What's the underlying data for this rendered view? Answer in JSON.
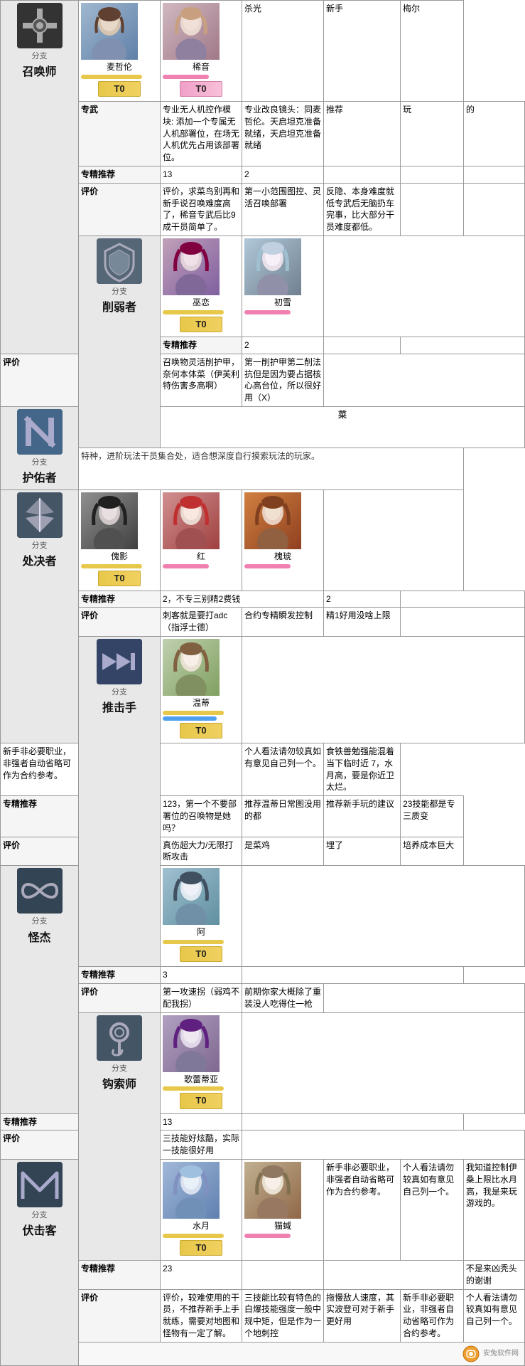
{
  "branches": [
    {
      "id": "summon",
      "name": "召唤师",
      "prefix": "分支",
      "icon_symbol": "⊕",
      "icon_bg": "#444",
      "characters": [
        {
          "name": "麦哲伦",
          "avatar_class": "avatar-麦哲伦",
          "tier": "T0",
          "tier_color": "gold",
          "bar_color": "gold"
        },
        {
          "name": "稀音",
          "avatar_class": "avatar-稀音",
          "tier": "T0",
          "tier_color": "pink",
          "bar_color": "pink"
        }
      ],
      "extra_headers": [
        "杀光",
        "新手",
        "梅尔"
      ],
      "specialty": {
        "label": "专武",
        "values": [
          "专业无人机控作模块: 添加一个专属无人机部署位，在场无人机优先占用该部署位。",
          "专业改良镜头: 同麦哲伦。天启坦克准备就绪, 天启坦克准备就绪",
          "推荐",
          "玩",
          "的"
        ]
      },
      "specialty_recommend": {
        "label": "专精推荐",
        "values": [
          "13",
          "2",
          "",
          "",
          ""
        ]
      },
      "evaluation": {
        "label": "评价",
        "value": "评价，求菜鸟别再和新手说召唤难度高了，稀音专武后比9成干员简单了。",
        "values": [
          "第一小范围图控、灵活召唤部署",
          "反隐、本身难度就低专武后无脑扔车完事，比大部分干员难度都低。",
          "",
          "",
          ""
        ]
      }
    },
    {
      "id": "weaken",
      "name": "削弱者",
      "prefix": "分支",
      "icon_symbol": "◇",
      "icon_bg": "#556",
      "characters": [
        {
          "name": "巫恋",
          "avatar_class": "avatar-巫恋",
          "tier": "T0",
          "tier_color": "gold",
          "bar_color": "gold"
        },
        {
          "name": "初雪",
          "avatar_class": "avatar-初雪",
          "tier": "",
          "tier_color": "pink",
          "bar_color": "pink"
        }
      ],
      "extra_headers": [],
      "specialty_recommend": {
        "label": "专精推荐",
        "values": [
          "2",
          "",
          "",
          "",
          ""
        ]
      },
      "evaluation": {
        "label": "评价",
        "values": [
          "召唤物灵活削护甲，奈何本体菜（伊芙利特伤害多高啊）",
          "第一削护甲第二削法抗但是因为要占据核心高台位，所以很好用（X）",
          "",
          "",
          ""
        ]
      }
    },
    {
      "id": "guard",
      "name": "护佑者",
      "prefix": "分支",
      "icon_symbol": "N",
      "icon_bg": "#446",
      "characters": [],
      "big_char": "菜",
      "extra_headers": [],
      "note": "特种，进阶玩法干员集合处，适合想深度自行摸索玩法的玩家。"
    },
    {
      "id": "execute",
      "name": "处决者",
      "prefix": "分支",
      "icon_symbol": "▲",
      "icon_bg": "#445",
      "characters": [
        {
          "name": "傀影",
          "avatar_class": "avatar-傀影",
          "tier": "T0",
          "tier_color": "gold",
          "bar_color": "gold"
        },
        {
          "name": "红",
          "avatar_class": "avatar-红",
          "tier": "",
          "tier_color": "pink",
          "bar_color": "pink"
        },
        {
          "name": "槐琥",
          "avatar_class": "avatar-槐琥",
          "tier": "",
          "tier_color": "pink",
          "bar_color": "pink"
        }
      ],
      "extra_headers": [],
      "specialty_recommend": {
        "label": "专精推荐",
        "values": [
          "2，不专三别精2费钱",
          "2",
          "",
          "",
          ""
        ]
      },
      "evaluation": {
        "label": "评价",
        "values": [
          "刺客就是要打adc（指浮士德）",
          "合约专精瞬发控制",
          "精1好用没啥上限",
          "",
          ""
        ]
      }
    },
    {
      "id": "push",
      "name": "推击手",
      "prefix": "分支",
      "icon_symbol": "▷▷",
      "icon_bg": "#335",
      "characters": [
        {
          "name": "温蒂",
          "avatar_class": "avatar-温蒂",
          "tier": "T0",
          "tier_color": "gold",
          "bar_color": "gold",
          "double_badge": true
        }
      ],
      "extra_headers": [],
      "specialty_recommend": {
        "label": "专精推荐",
        "values": [
          "123，第一个不要部署位的召唤物是她吗？",
          "推荐温蒂日常图没用的都",
          "推荐新手玩的建议",
          "23技能都是专三质变"
        ]
      },
      "evaluation": {
        "label": "评价",
        "values": [
          "真伤超大力/无限打断攻击",
          "是菜鸡",
          "埋了",
          "培养成本巨大"
        ],
        "extra": [
          "新手非必要职业，非强者自动省略可作为合约参考。",
          "",
          "个人看法请勿较真如有意见自己列一个。",
          "食铁兽勉强能混着当下临时近 7 水月高，要是你近卫太烂。"
        ]
      }
    },
    {
      "id": "weird",
      "name": "怪杰",
      "prefix": "分支",
      "icon_symbol": "∞",
      "icon_bg": "#334",
      "characters": [
        {
          "name": "阿",
          "avatar_class": "avatar-阿",
          "tier": "T0",
          "tier_color": "gold",
          "bar_color": "gold"
        }
      ],
      "extra_headers": [],
      "specialty_recommend": {
        "label": "专精推荐",
        "values": [
          "3",
          "",
          "",
          ""
        ]
      },
      "evaluation": {
        "label": "评价",
        "values": [
          "第一攻速拐（弱鸡不配我拐）",
          "前期你家大概除了重装没人吃得住一枪",
          "",
          ""
        ]
      }
    },
    {
      "id": "hook",
      "name": "钩索师",
      "prefix": "分支",
      "icon_symbol": "⊙",
      "icon_bg": "#445",
      "characters": [
        {
          "name": "歌蕾蒂亚",
          "avatar_class": "avatar-歌蕾蒂亚",
          "tier": "T0",
          "tier_color": "gold",
          "bar_color": "gold"
        }
      ],
      "extra_headers": [],
      "specialty_recommend": {
        "label": "专精推荐",
        "values": [
          "13",
          "",
          "",
          ""
        ]
      },
      "evaluation": {
        "label": "评价",
        "values": [
          "三技能好炫酷，实际一技能很好用",
          "",
          "",
          ""
        ]
      }
    },
    {
      "id": "ambush",
      "name": "伏击客",
      "prefix": "分支",
      "icon_symbol": "M",
      "icon_bg": "#334",
      "characters": [
        {
          "name": "水月",
          "avatar_class": "avatar-水月",
          "tier": "T0",
          "tier_color": "gold",
          "bar_color": "gold"
        },
        {
          "name": "猫蜮",
          "avatar_class": "avatar-猫蜮",
          "tier": "",
          "tier_color": "pink",
          "bar_color": "pink"
        }
      ],
      "extra_headers": [],
      "specialty_recommend": {
        "label": "专精推荐",
        "values": [
          "23",
          "",
          "不是来凶秃头的谢谢"
        ]
      },
      "evaluation": {
        "label": "评价",
        "value": "评价，较难使用的干员，不推荐新手上手就练，需要对地图和怪物有一定了解。",
        "values": [
          "三技能比较有特色的白爆技能强度一般中规中矩，但是作为一个地刺控",
          "拖慢敌人速度，其实波登可对于新手更好用",
          "新手非必要职业，非强者自动省略可作为合约参考。",
          "个人看法请勿较真如有意见自己列一个。",
          "我知道控制伊桑上限比水月高，我是来玩游戏的。"
        ]
      }
    }
  ],
  "column_headers": [
    "杀光",
    "新手",
    "梅尔"
  ],
  "watermark": "安兔软件网"
}
